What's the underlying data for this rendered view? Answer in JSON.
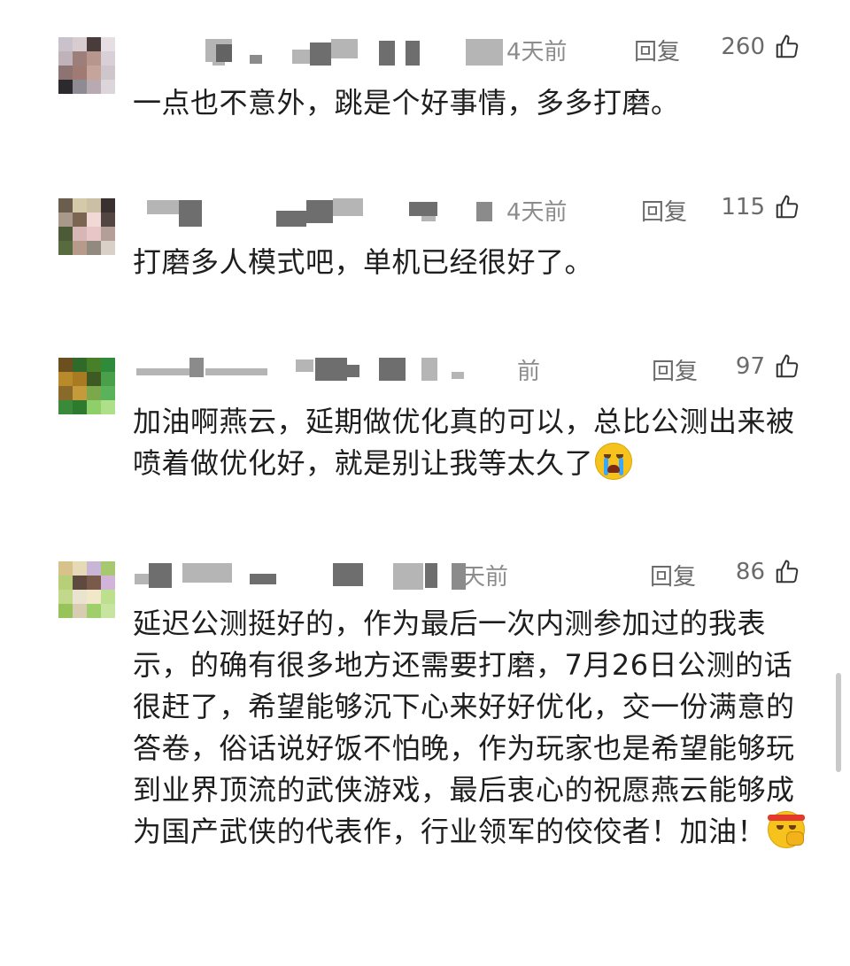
{
  "comments": [
    {
      "time": "4天前",
      "reply": "回复",
      "likes": "260",
      "text": "一点也不意外，跳是个好事情，多多打磨。"
    },
    {
      "time": "4天前",
      "reply": "回复",
      "likes": "115",
      "text": "打磨多人模式吧，单机已经很好了。"
    },
    {
      "time": "前",
      "reply": "回复",
      "likes": "97",
      "text": "加油啊燕云，延期做优化真的可以，总比公测出来被喷着做优化好，就是别让我等太久了"
    },
    {
      "time": "天前",
      "reply": "回复",
      "likes": "86",
      "text": "延迟公测挺好的，作为最后一次内测参加过的我表示，的确有很多地方还需要打磨，7月26日公测的话很赶了，希望能够沉下心来好好优化，交一份满意的答卷，俗话说好饭不怕晚，作为玩家也是希望能够玩到业界顶流的武侠游戏，最后衷心的祝愿燕云能够成为国产武侠的代表作，行业领军的佼佼者！加油！"
    }
  ],
  "icons": {
    "like": "thumbs-up-icon",
    "emoji_3": "loudly-crying-face-emoji",
    "emoji_4": "determined-face-headband-emoji"
  },
  "colors": {
    "text": "#1e1e1e",
    "meta": "#6b6b6b",
    "time": "#8c8c8c",
    "background": "#ffffff"
  }
}
